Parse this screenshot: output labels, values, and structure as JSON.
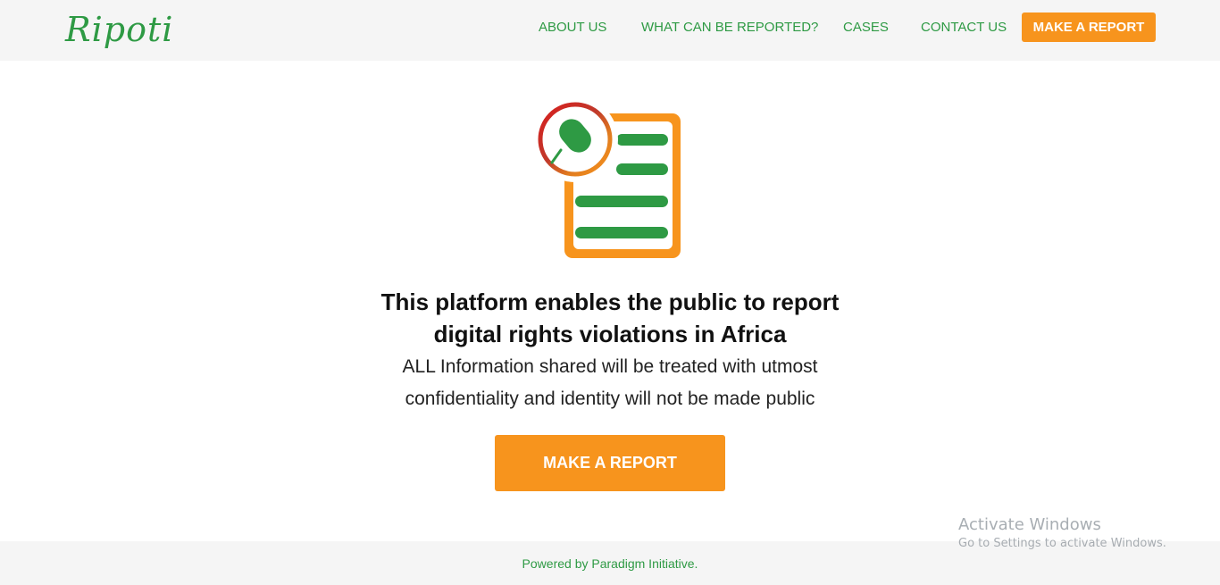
{
  "brand": {
    "logo_text": "Ripoti",
    "green": "#2e9a44",
    "orange": "#f7941d"
  },
  "nav": {
    "items": [
      {
        "label": "ABOUT US"
      },
      {
        "label": "WHAT CAN BE REPORTED?"
      },
      {
        "label": "CASES"
      },
      {
        "label": "CONTACT US"
      }
    ],
    "cta_label": "MAKE A REPORT"
  },
  "hero": {
    "icon": "report-document-icon",
    "headline_line1": "This platform enables the public to report",
    "headline_line2": "digital rights violations in Africa",
    "subtext_line1": "ALL Information shared will be treated with utmost",
    "subtext_line2": "confidentiality and identity will not be made public",
    "cta_label": "MAKE A REPORT"
  },
  "footer": {
    "prefix": "Powered by ",
    "link_text": "Paradigm Initiative."
  },
  "watermark": {
    "title": "Activate Windows",
    "subtitle": "Go to Settings to activate Windows."
  }
}
